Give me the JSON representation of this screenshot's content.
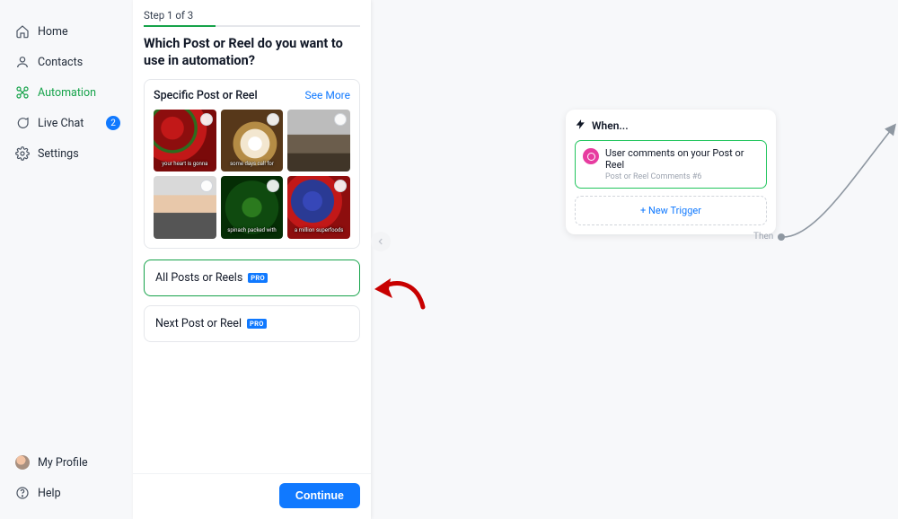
{
  "sidebar": {
    "items": [
      {
        "label": "Home"
      },
      {
        "label": "Contacts"
      },
      {
        "label": "Automation"
      },
      {
        "label": "Live Chat",
        "badge": "2"
      },
      {
        "label": "Settings"
      }
    ],
    "profile": "My Profile",
    "help": "Help"
  },
  "panel": {
    "step_label": "Step 1 of 3",
    "title": "Which Post or Reel do you want to use in automation?",
    "specific": {
      "title": "Specific Post or Reel",
      "see_more": "See More",
      "thumbs": [
        {
          "caption": "your heart is gonna"
        },
        {
          "caption": "some days call for"
        },
        {
          "caption": ""
        },
        {
          "caption": ""
        },
        {
          "caption": "spinach packed with"
        },
        {
          "caption": "a million superfoods"
        }
      ]
    },
    "all_posts": {
      "label": "All Posts or Reels",
      "badge": "PRO"
    },
    "next_post": {
      "label": "Next Post or Reel",
      "badge": "PRO"
    },
    "continue": "Continue"
  },
  "flow": {
    "when": "When...",
    "trigger": {
      "line1": "User comments on your Post or Reel",
      "line2": "Post or Reel Comments #6"
    },
    "new_trigger": "+ New Trigger",
    "then": "Then"
  }
}
